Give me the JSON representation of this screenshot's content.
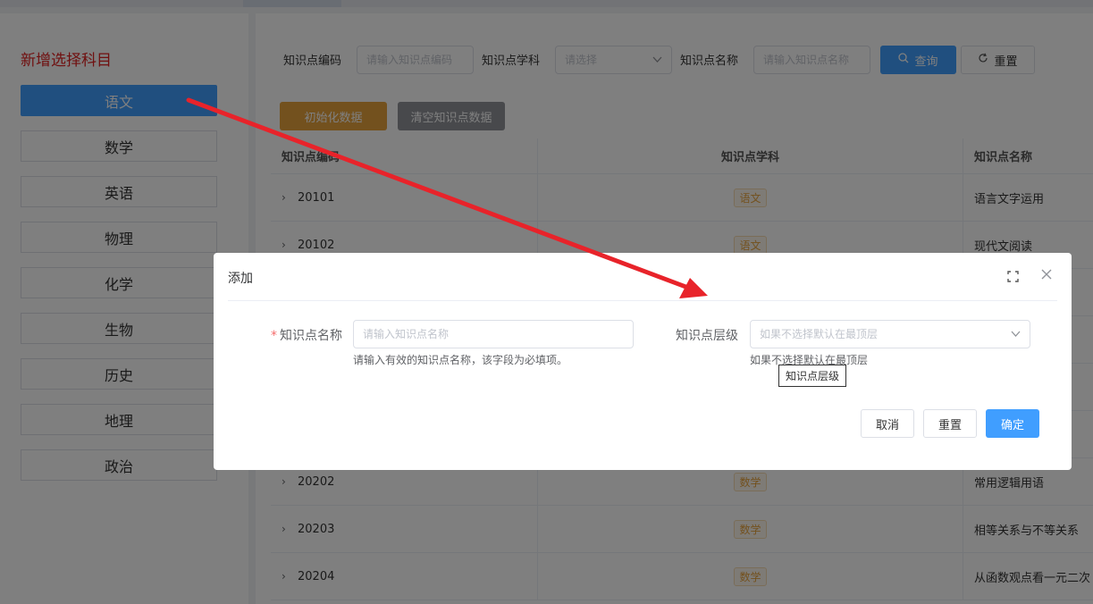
{
  "left": {
    "title": "新增选择科目",
    "subjects": [
      "语文",
      "数学",
      "英语",
      "物理",
      "化学",
      "生物",
      "历史",
      "地理",
      "政治"
    ]
  },
  "search": {
    "code_label": "知识点编码",
    "code_placeholder": "请输入知识点编码",
    "subject_label": "知识点学科",
    "subject_placeholder": "请选择",
    "name_label": "知识点名称",
    "name_placeholder": "请输入知识点名称",
    "query": "查询",
    "reset": "重置"
  },
  "actions": {
    "init": "初始化数据",
    "clear": "清空知识点数据"
  },
  "table": {
    "headers": [
      "知识点编码",
      "知识点学科",
      "知识点名称"
    ],
    "rows": [
      {
        "code": "20101",
        "subject": "语文",
        "name": "语言文字运用"
      },
      {
        "code": "20102",
        "subject": "语文",
        "name": "现代文阅读"
      },
      {
        "code": "20202",
        "subject": "数学",
        "name": "常用逻辑用语"
      },
      {
        "code": "20203",
        "subject": "数学",
        "name": "相等关系与不等关系"
      },
      {
        "code": "20204",
        "subject": "数学",
        "name": "从函数观点看一元二次"
      }
    ]
  },
  "dialog": {
    "title": "添加",
    "name_label": "知识点名称",
    "name_placeholder": "请输入知识点名称",
    "name_hint": "请输入有效的知识点名称，该字段为必填项。",
    "level_label": "知识点层级",
    "level_placeholder": "如果不选择默认在最顶层",
    "level_hint": "如果不选择默认在最顶层",
    "tooltip": "知识点层级",
    "cancel": "取消",
    "reset": "重置",
    "ok": "确定"
  },
  "colors": {
    "primary": "#409eff",
    "warning": "#e6a23c",
    "info": "#909399",
    "annotation": "#e8232a"
  }
}
